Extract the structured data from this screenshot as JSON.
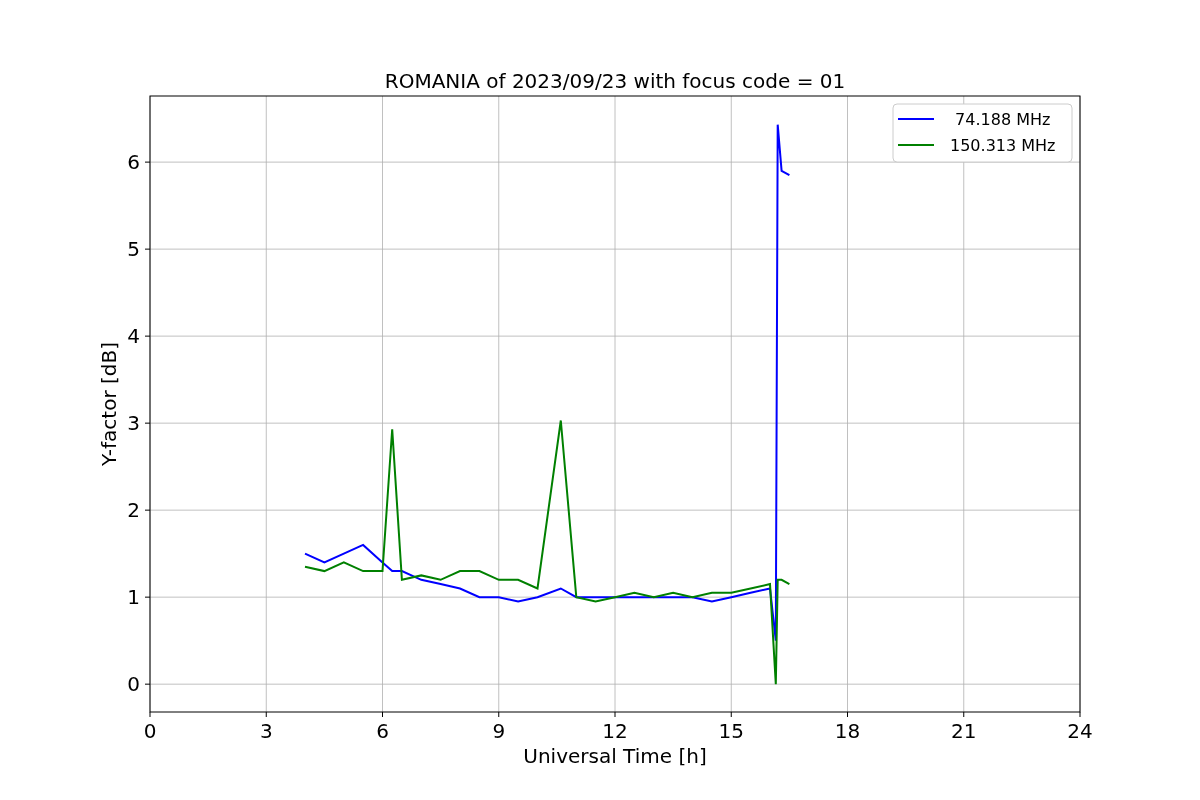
{
  "figure": {
    "chart_data": {
      "type": "line",
      "title": "ROMANIA of 2023/09/23 with focus code = 01",
      "xlabel": "Universal Time [h]",
      "ylabel": "Y-factor [dB]",
      "x": [
        4,
        4.5,
        5,
        5.5,
        6,
        6.25,
        6.5,
        7,
        7.5,
        8,
        8.5,
        9,
        9.5,
        10,
        10.6,
        11,
        11.5,
        12,
        12.5,
        13,
        13.5,
        14,
        14.5,
        15,
        15.5,
        16,
        16.15,
        16.2,
        16.3,
        16.5
      ],
      "series": [
        {
          "name": " 74.188 MHz",
          "color": "#0000ff",
          "values": [
            1.5,
            1.4,
            1.5,
            1.6,
            1.4,
            1.3,
            1.3,
            1.2,
            1.15,
            1.1,
            1.0,
            1.0,
            0.95,
            1.0,
            1.1,
            1.0,
            1.0,
            1.0,
            1.0,
            1.0,
            1.0,
            1.0,
            0.95,
            1.0,
            1.05,
            1.1,
            0.5,
            6.43,
            5.9,
            5.85
          ]
        },
        {
          "name": "150.313 MHz",
          "color": "#008000",
          "values": [
            1.35,
            1.3,
            1.4,
            1.3,
            1.3,
            2.93,
            1.2,
            1.25,
            1.2,
            1.3,
            1.3,
            1.2,
            1.2,
            1.1,
            3.03,
            1.0,
            0.95,
            1.0,
            1.05,
            1.0,
            1.05,
            1.0,
            1.05,
            1.05,
            1.1,
            1.15,
            0.0,
            1.2,
            1.2,
            1.15
          ]
        }
      ],
      "xlim": [
        0,
        24
      ],
      "ylim": [
        -0.32,
        6.76
      ],
      "xticks": [
        0,
        3,
        6,
        9,
        12,
        15,
        18,
        21,
        24
      ],
      "yticks": [
        0,
        1,
        2,
        3,
        4,
        5,
        6
      ],
      "grid": true,
      "legend": true
    }
  }
}
